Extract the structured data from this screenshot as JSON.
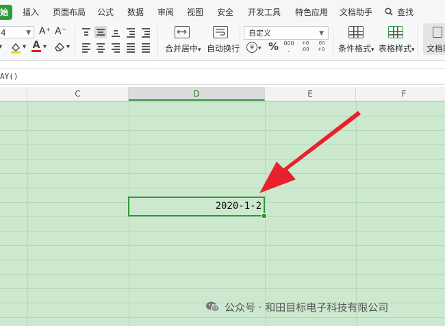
{
  "menu": {
    "tabs": [
      "始",
      "插入",
      "页面布局",
      "公式",
      "数据",
      "审阅",
      "视图",
      "安全",
      "开发工具",
      "特色应用",
      "文档助手",
      "查找"
    ]
  },
  "ribbon": {
    "font_size": "4",
    "grow_font": "A⁺",
    "shrink_font": "A⁻",
    "merge_center": "合并居中",
    "wrap_text": "自动换行",
    "number_format": "自定义",
    "currency_symbol": "¥",
    "percent_symbol": "%",
    "thousands_glyph": "000",
    "increase_decimal": "+0 .00",
    "decrease_decimal": ".00 +0",
    "conditional_format": "条件格式",
    "table_style": "表格样式",
    "doc_partial": "文档助"
  },
  "formula_bar": {
    "content": "AY()"
  },
  "columns": [
    "C",
    "D",
    "E",
    "F"
  ],
  "selected_column": "D",
  "selected_cell": {
    "value": "2020-1-2"
  },
  "watermark": {
    "text": "公众号 · 和田目标电子科技有限公司"
  },
  "colors": {
    "accent": "#2e9a3a",
    "grid_bg": "#cce8cf",
    "arrow": "#e8222a"
  }
}
